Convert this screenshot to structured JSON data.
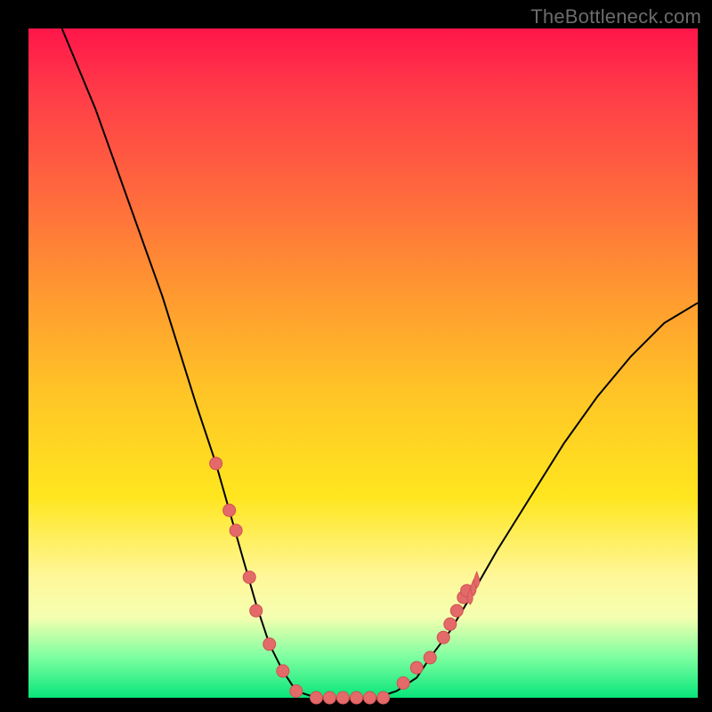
{
  "watermark": "TheBottleneck.com",
  "chart_data": {
    "type": "line",
    "title": "",
    "xlabel": "",
    "ylabel": "",
    "xlim": [
      0,
      100
    ],
    "ylim": [
      0,
      100
    ],
    "grid": false,
    "legend": false,
    "series": [
      {
        "name": "bottleneck-curve",
        "x": [
          5,
          10,
          15,
          20,
          25,
          28,
          30,
          32,
          34,
          36,
          38,
          40,
          43,
          46,
          48,
          50,
          52,
          55,
          58,
          60,
          63,
          66,
          70,
          75,
          80,
          85,
          90,
          95,
          100
        ],
        "y": [
          100,
          88,
          74,
          60,
          44,
          35,
          28,
          21,
          14,
          8,
          4,
          1,
          0,
          0,
          0,
          0,
          0,
          1,
          3,
          6,
          10,
          15,
          22,
          30,
          38,
          45,
          51,
          56,
          59
        ]
      }
    ],
    "markers_left": [
      {
        "x": 28,
        "y": 35
      },
      {
        "x": 30,
        "y": 28
      },
      {
        "x": 31,
        "y": 25
      },
      {
        "x": 33,
        "y": 18
      },
      {
        "x": 34,
        "y": 13
      },
      {
        "x": 36,
        "y": 8
      },
      {
        "x": 38,
        "y": 4
      },
      {
        "x": 40,
        "y": 1
      }
    ],
    "markers_bottom": [
      {
        "x": 43,
        "y": 0
      },
      {
        "x": 45,
        "y": 0
      },
      {
        "x": 47,
        "y": 0
      },
      {
        "x": 49,
        "y": 0
      },
      {
        "x": 51,
        "y": 0
      },
      {
        "x": 53,
        "y": 0
      }
    ],
    "markers_right": [
      {
        "x": 56,
        "y": 2.2
      },
      {
        "x": 58,
        "y": 4.5
      },
      {
        "x": 60,
        "y": 6
      },
      {
        "x": 62,
        "y": 9
      },
      {
        "x": 63,
        "y": 11
      },
      {
        "x": 64,
        "y": 13
      },
      {
        "x": 65,
        "y": 15
      },
      {
        "x": 65.5,
        "y": 16
      }
    ],
    "flame_markers_right": [
      {
        "x": 66,
        "y": 15
      },
      {
        "x": 66.5,
        "y": 16.3
      },
      {
        "x": 67,
        "y": 17.5
      }
    ],
    "colors": {
      "curve": "#000000",
      "marker_fill": "#e46a6a",
      "marker_stroke": "#d05050",
      "gradient_top": "#ff164a",
      "gradient_bottom": "#08e57a",
      "frame": "#000000"
    }
  }
}
